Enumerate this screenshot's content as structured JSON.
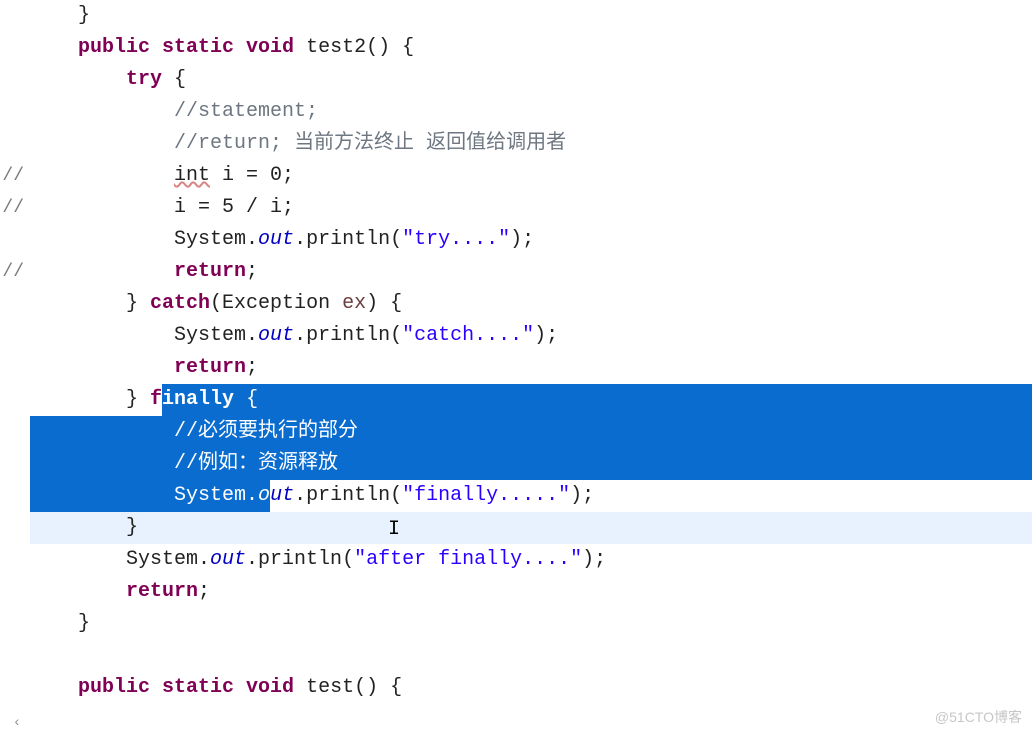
{
  "gutter": {
    "markers": [
      "",
      "",
      "",
      "",
      "",
      " //",
      " //",
      "",
      " //",
      "",
      "",
      "",
      "",
      "",
      "",
      "",
      "",
      "",
      "",
      "",
      "",
      ""
    ]
  },
  "code_text": {
    "l0": "    }",
    "l1_pre": "    ",
    "l1_kw": "public static void",
    "l1_rest": " test2() {",
    "l2_pre": "        ",
    "l2_kw": "try",
    "l2_rest": " {",
    "l3_pre": "            ",
    "l3_c": "//statement;",
    "l4_pre": "            ",
    "l4_c": "//return; ",
    "l4_ch": "当前方法终止 返回值给调用者",
    "l5_pre": "            ",
    "l5_u": "int",
    "l5_rest": " i = 0;",
    "l6_pre": "            ",
    "l6_rest": "i = 5 / i;",
    "l7_pre": "            System.",
    "l7_out": "out",
    "l7_mid": ".println(",
    "l7_str": "\"try....\"",
    "l7_end": ");",
    "l8_pre": "            ",
    "l8_kw": "return",
    "l8_end": ";",
    "l9_pre": "        } ",
    "l9_kw": "catch",
    "l9_rest": "(Exception ",
    "l9_param": "ex",
    "l9_end": ") {",
    "l10_pre": "            System.",
    "l10_out": "out",
    "l10_mid": ".println(",
    "l10_str": "\"catch....\"",
    "l10_end": ");",
    "l11_pre": "            ",
    "l11_kw": "return",
    "l11_end": ";",
    "l12_pre": "        } ",
    "l12_f_pre": "f",
    "l12_kw_sel": "inally ",
    "l12_brace": "{",
    "l13_pre": "            ",
    "l13_c": "//必须要执行的部分",
    "l14_pre": "            ",
    "l14_c": "//例如：资源释放",
    "l15_pre": "            ",
    "l15_sys": "System.",
    "l15_out": "out",
    "l15_mid": ".println(",
    "l15_str": "\"finally.....\"",
    "l15_end": ");",
    "l16": "        }",
    "l17_pre": "        System.",
    "l17_out": "out",
    "l17_mid": ".println(",
    "l17_str": "\"after finally....\"",
    "l17_end": ");",
    "l18_pre": "        ",
    "l18_kw": "return",
    "l18_end": ";",
    "l19": "    }",
    "l20": "",
    "l21_pre": "    ",
    "l21_kw": "public static void",
    "l21_rest": " test() {"
  },
  "watermark": "@51CTO博客",
  "scroll_left_glyph": "‹"
}
